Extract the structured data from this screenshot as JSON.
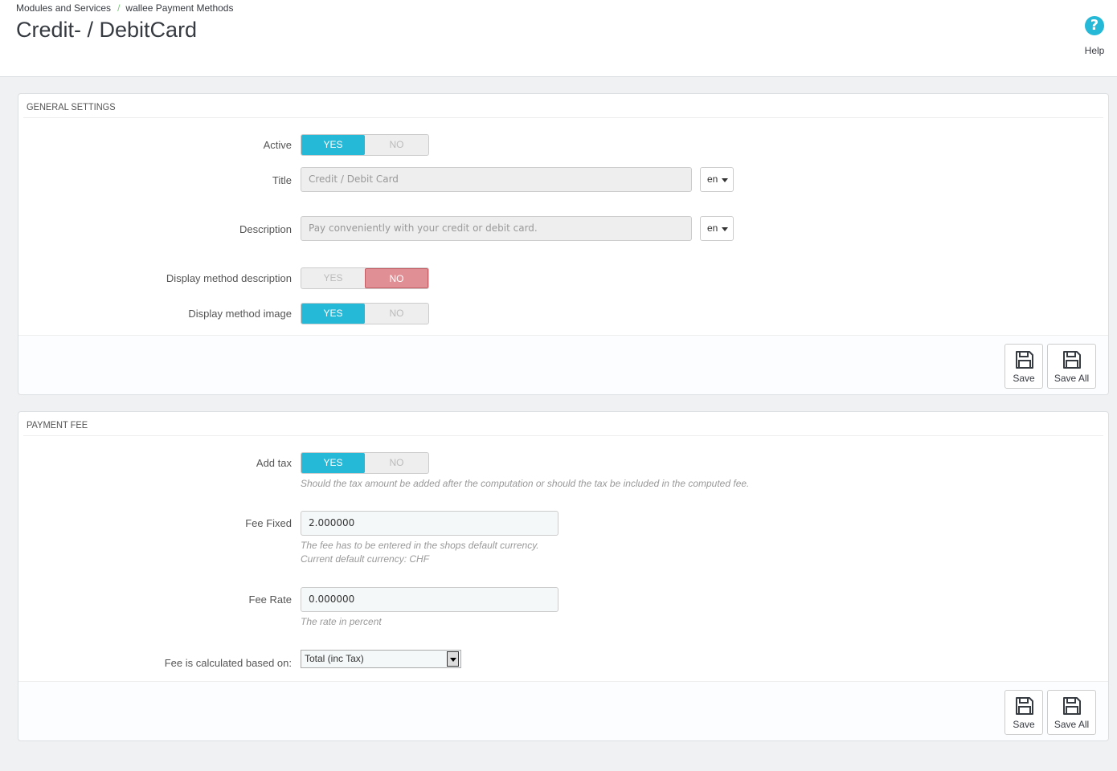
{
  "breadcrumb": {
    "items": [
      "Modules and Services",
      "wallee Payment Methods"
    ],
    "separator": "/"
  },
  "page": {
    "title": "Credit- / DebitCard"
  },
  "help": {
    "label": "Help",
    "icon": "question-circle-icon"
  },
  "general": {
    "heading": "GENERAL SETTINGS",
    "active": {
      "label": "Active",
      "yes": "YES",
      "no": "NO",
      "value": "YES"
    },
    "title": {
      "label": "Title",
      "value": "Credit / Debit Card",
      "lang": "en"
    },
    "description": {
      "label": "Description",
      "value": "Pay conveniently with your credit or debit card.",
      "lang": "en"
    },
    "display_description": {
      "label": "Display method description",
      "yes": "YES",
      "no": "NO",
      "value": "NO"
    },
    "display_image": {
      "label": "Display method image",
      "yes": "YES",
      "no": "NO",
      "value": "YES"
    },
    "save": "Save",
    "save_all": "Save All"
  },
  "fee": {
    "heading": "PAYMENT FEE",
    "add_tax": {
      "label": "Add tax",
      "yes": "YES",
      "no": "NO",
      "value": "YES",
      "help": "Should the tax amount be added after the computation or should the tax be included in the computed fee."
    },
    "fixed": {
      "label": "Fee Fixed",
      "value": "2.000000",
      "help_line1": "The fee has to be entered in the shops default currency.",
      "help_line2": "Current default currency: CHF"
    },
    "rate": {
      "label": "Fee Rate",
      "value": "0.000000",
      "help": "The rate in percent"
    },
    "base": {
      "label": "Fee is calculated based on:",
      "value": "Total (inc Tax)"
    },
    "save": "Save",
    "save_all": "Save All"
  },
  "colors": {
    "accent": "#25b9d7",
    "no_active": "#e08f95",
    "title": "#363a41"
  }
}
